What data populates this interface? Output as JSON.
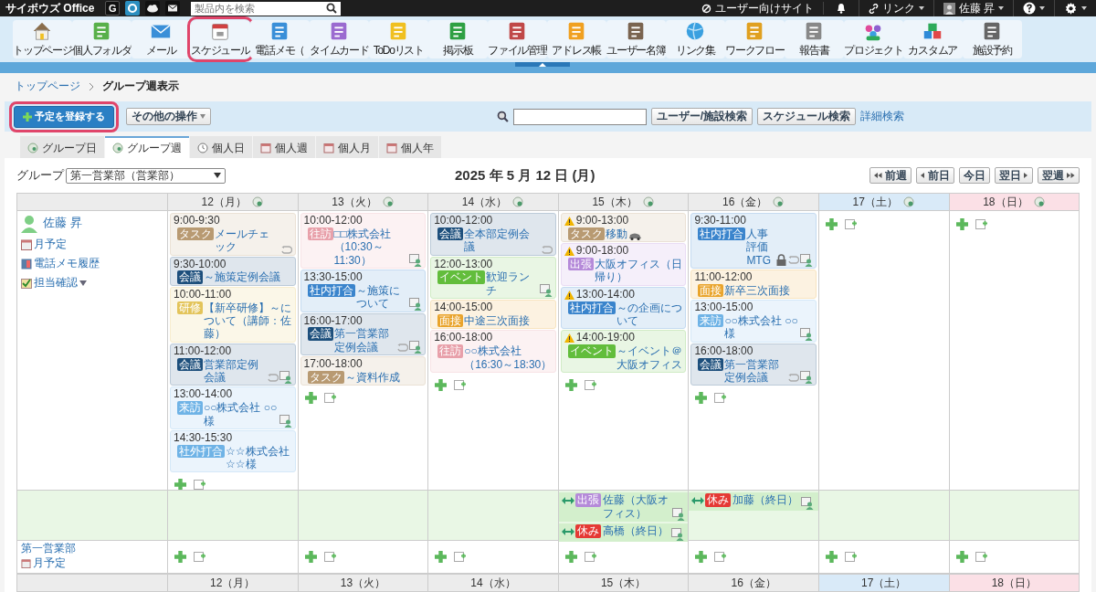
{
  "topbar": {
    "logo": "サイボウズ Office",
    "quick_link": "G",
    "search": {
      "placeholder": "製品内を検索"
    },
    "site_link": "ユーザー向けサイト",
    "link_menu": "リンク",
    "user": "佐藤 昇"
  },
  "apps": [
    {
      "label": "トップページ",
      "selected": false
    },
    {
      "label": "個人フォルダ",
      "selected": false
    },
    {
      "label": "メール",
      "selected": false
    },
    {
      "label": "スケジュール",
      "selected": true
    },
    {
      "label": "電話メモ（",
      "selected": false
    },
    {
      "label": "タイムカード",
      "selected": false
    },
    {
      "label": "ToDoリスト",
      "selected": false
    },
    {
      "label": "掲示板",
      "selected": false
    },
    {
      "label": "ファイル管理",
      "selected": false
    },
    {
      "label": "アドレス帳",
      "selected": false
    },
    {
      "label": "ユーザー名簿",
      "selected": false
    },
    {
      "label": "リンク集",
      "selected": false
    },
    {
      "label": "ワークフロー",
      "selected": false
    },
    {
      "label": "報告書",
      "selected": false
    },
    {
      "label": "プロジェクト",
      "selected": false
    },
    {
      "label": "カスタムア",
      "selected": false
    },
    {
      "label": "施設予約",
      "selected": false
    }
  ],
  "breadcrumb": [
    "トップページ",
    "グループ週表示"
  ],
  "toolbar": {
    "add_button": "予定を登録する",
    "other_actions": "その他の操作",
    "buttons": [
      "ユーザー/施設検索",
      "スケジュール検索"
    ],
    "detail_link": "詳細検索"
  },
  "tabs": [
    {
      "label": "グループ日",
      "selected": false
    },
    {
      "label": "グループ週",
      "selected": true
    },
    {
      "label": "個人日",
      "selected": false
    },
    {
      "label": "個人週",
      "selected": false
    },
    {
      "label": "個人月",
      "selected": false
    },
    {
      "label": "個人年",
      "selected": false
    }
  ],
  "calendar": {
    "group_label": "グループ",
    "group_select": "第一営業部（営業部）",
    "title": "2025 年 5 月 12 日 (月)",
    "nav": [
      {
        "label": "前週",
        "kind": "rewind"
      },
      {
        "label": "前日",
        "kind": "back"
      },
      {
        "label": "今日",
        "kind": "none"
      },
      {
        "label": "翌日",
        "kind": "forward"
      },
      {
        "label": "翌週",
        "kind": "fastforward"
      }
    ],
    "member": {
      "name": "佐藤 昇",
      "links": [
        "月予定",
        "電話メモ履歴",
        "担当確認"
      ]
    },
    "days": [
      {
        "label": "12（月）",
        "kind": "weekday",
        "events": [
          {
            "time": "9:00-9:30",
            "warning": false,
            "tag": {
              "label": "タスク",
              "color": "#b89a72"
            },
            "title": "メールチェック",
            "repeat": true,
            "attendees": false,
            "lock": false,
            "vehicle": false
          },
          {
            "time": "9:30-10:00",
            "warning": false,
            "tag": {
              "label": "会議",
              "color": "#1d4f7c"
            },
            "title": "～施策定例会議",
            "repeat": false,
            "attendees": false,
            "lock": false,
            "vehicle": false
          },
          {
            "time": "10:00-11:00",
            "warning": false,
            "tag": {
              "label": "研修",
              "color": "#e3c45a"
            },
            "title": "【新卒研修】～について（講師：佐藤）",
            "repeat": false,
            "attendees": false,
            "lock": false,
            "vehicle": false
          },
          {
            "time": "11:00-12:00",
            "warning": false,
            "tag": {
              "label": "会議",
              "color": "#1d4f7c"
            },
            "title": "営業部定例会議",
            "repeat": true,
            "attendees": true,
            "lock": false,
            "vehicle": false
          },
          {
            "time": "13:00-14:00",
            "warning": false,
            "tag": {
              "label": "来訪",
              "color": "#6fb3e6"
            },
            "title": "○○株式会社 ○○様",
            "repeat": false,
            "attendees": true,
            "lock": false,
            "vehicle": false
          },
          {
            "time": "14:30-15:30",
            "warning": false,
            "tag": {
              "label": "社外打合",
              "color": "#6fb3e6"
            },
            "title": "☆☆株式会社☆☆様",
            "repeat": false,
            "attendees": false,
            "lock": false,
            "vehicle": false
          }
        ]
      },
      {
        "label": "13（火）",
        "kind": "weekday",
        "events": [
          {
            "time": "10:00-12:00",
            "warning": false,
            "tag": {
              "label": "往訪",
              "color": "#e8a0aa"
            },
            "title": "□□株式会社（10:30～11:30）",
            "repeat": false,
            "attendees": true,
            "lock": false,
            "vehicle": false
          },
          {
            "time": "13:30-15:00",
            "warning": false,
            "tag": {
              "label": "社内打合",
              "color": "#3a84cc"
            },
            "title": "～施策について",
            "repeat": false,
            "attendees": true,
            "lock": false,
            "vehicle": false
          },
          {
            "time": "16:00-17:00",
            "warning": false,
            "tag": {
              "label": "会議",
              "color": "#1d4f7c"
            },
            "title": "第一営業部定例会議",
            "repeat": true,
            "attendees": true,
            "lock": false,
            "vehicle": false
          },
          {
            "time": "17:00-18:00",
            "warning": false,
            "tag": {
              "label": "タスク",
              "color": "#b89a72"
            },
            "title": "～資料作成",
            "repeat": false,
            "attendees": false,
            "lock": false,
            "vehicle": false
          }
        ]
      },
      {
        "label": "14（水）",
        "kind": "weekday",
        "events": [
          {
            "time": "10:00-12:00",
            "warning": false,
            "tag": {
              "label": "会議",
              "color": "#1d4f7c"
            },
            "title": "全本部定例会議",
            "repeat": true,
            "attendees": false,
            "lock": false,
            "vehicle": false
          },
          {
            "time": "12:00-13:00",
            "warning": false,
            "tag": {
              "label": "イベント",
              "color": "#62bd3c"
            },
            "title": "歓迎ランチ",
            "repeat": false,
            "attendees": true,
            "lock": false,
            "vehicle": false
          },
          {
            "time": "14:00-15:00",
            "warning": false,
            "tag": {
              "label": "面接",
              "color": "#e9a42c"
            },
            "title": "中途三次面接",
            "repeat": false,
            "attendees": false,
            "lock": false,
            "vehicle": false
          },
          {
            "time": "16:00-18:00",
            "warning": false,
            "tag": {
              "label": "往訪",
              "color": "#e8a0aa"
            },
            "title": "○○株式会社（16:30～18:30）",
            "repeat": false,
            "attendees": false,
            "lock": false,
            "vehicle": false
          }
        ]
      },
      {
        "label": "15（木）",
        "kind": "weekday",
        "events": [
          {
            "time": "9:00-13:00",
            "warning": true,
            "tag": {
              "label": "タスク",
              "color": "#b89a72"
            },
            "title": "移動",
            "repeat": false,
            "attendees": false,
            "lock": false,
            "vehicle": true
          },
          {
            "time": "9:00-18:00",
            "warning": true,
            "tag": {
              "label": "出張",
              "color": "#b58ad9"
            },
            "title": "大阪オフィス（日帰り）",
            "repeat": false,
            "attendees": false,
            "lock": false,
            "vehicle": false
          },
          {
            "time": "13:00-14:00",
            "warning": true,
            "tag": {
              "label": "社内打合",
              "color": "#3a84cc"
            },
            "title": "～の企画について",
            "repeat": false,
            "attendees": false,
            "lock": false,
            "vehicle": false
          },
          {
            "time": "14:00-19:00",
            "warning": true,
            "tag": {
              "label": "イベント",
              "color": "#62bd3c"
            },
            "title": "～イベント＠大阪オフィス",
            "repeat": false,
            "attendees": false,
            "lock": false,
            "vehicle": false
          }
        ],
        "banners": [
          {
            "tag": {
              "label": "出張",
              "color": "#b58ad9"
            },
            "title": "佐藤（大阪オフィス）"
          },
          {
            "tag": {
              "label": "休み",
              "color": "#e53935"
            },
            "title": "高橋（終日）"
          }
        ]
      },
      {
        "label": "16（金）",
        "kind": "weekday",
        "events": [
          {
            "time": "9:30-11:00",
            "warning": false,
            "tag": {
              "label": "社内打合",
              "color": "#3a84cc"
            },
            "title": "人事評価MTG",
            "repeat": true,
            "attendees": true,
            "lock": true,
            "vehicle": false
          },
          {
            "time": "11:00-12:00",
            "warning": false,
            "tag": {
              "label": "面接",
              "color": "#e9a42c"
            },
            "title": "新卒三次面接",
            "repeat": false,
            "attendees": false,
            "lock": false,
            "vehicle": false
          },
          {
            "time": "13:00-15:00",
            "warning": false,
            "tag": {
              "label": "来訪",
              "color": "#6fb3e6"
            },
            "title": "○○株式会社 ○○様",
            "repeat": false,
            "attendees": true,
            "lock": false,
            "vehicle": false
          },
          {
            "time": "16:00-18:00",
            "warning": false,
            "tag": {
              "label": "会議",
              "color": "#1d4f7c"
            },
            "title": "第一営業部定例会議",
            "repeat": true,
            "attendees": true,
            "lock": false,
            "vehicle": false
          }
        ],
        "banners": [
          {
            "tag": {
              "label": "休み",
              "color": "#e53935"
            },
            "title": "加藤（終日）"
          }
        ]
      },
      {
        "label": "17（土）",
        "kind": "saturday"
      },
      {
        "label": "18（日）",
        "kind": "sunday"
      }
    ],
    "group": {
      "name": "第一営業部",
      "link": "月予定"
    },
    "footer_days": [
      {
        "label": "12（月）",
        "kind": "weekday"
      },
      {
        "label": "13（火）",
        "kind": "weekday"
      },
      {
        "label": "14（水）",
        "kind": "weekday"
      },
      {
        "label": "15（木）",
        "kind": "weekday"
      },
      {
        "label": "16（金）",
        "kind": "weekday"
      },
      {
        "label": "17（土）",
        "kind": "saturday"
      },
      {
        "label": "18（日）",
        "kind": "sunday"
      }
    ]
  }
}
